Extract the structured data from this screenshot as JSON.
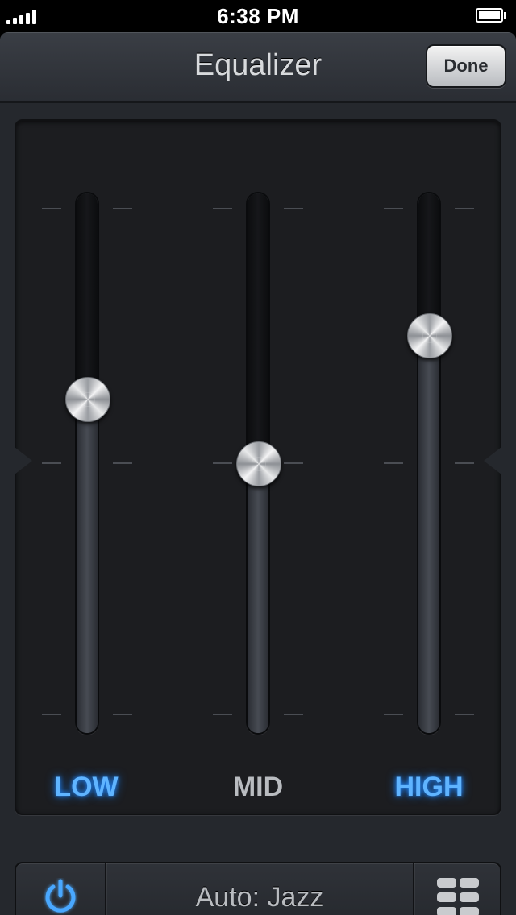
{
  "status_bar": {
    "time": "6:38 PM"
  },
  "nav": {
    "title": "Equalizer",
    "done_label": "Done"
  },
  "bands": [
    {
      "label": "LOW",
      "level": 0.63,
      "active": true
    },
    {
      "label": "MID",
      "level": 0.5,
      "active": false
    },
    {
      "label": "HIGH",
      "level": 0.76,
      "active": true
    }
  ],
  "toolbar": {
    "power_icon": "power-icon",
    "preset_label": "Auto: Jazz",
    "presets_icon": "grid-icon"
  },
  "colors": {
    "accent": "#5fb4ff",
    "active_glow": "#1f88ff",
    "inactive_text": "#b9bcc0"
  }
}
